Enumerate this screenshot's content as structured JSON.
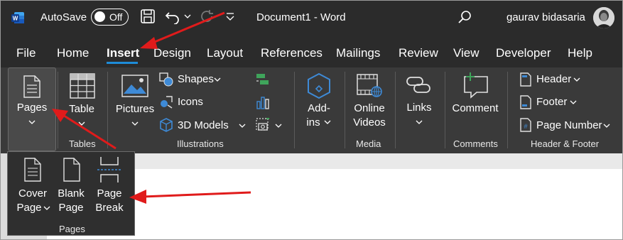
{
  "titlebar": {
    "autosave_label": "AutoSave",
    "autosave_state": "Off",
    "doc_title": "Document1  -  Word",
    "user_name": "gaurav bidasaria"
  },
  "tabs": [
    {
      "label": "File"
    },
    {
      "label": "Home"
    },
    {
      "label": "Insert",
      "active": true
    },
    {
      "label": "Design"
    },
    {
      "label": "Layout"
    },
    {
      "label": "References"
    },
    {
      "label": "Mailings"
    },
    {
      "label": "Review"
    },
    {
      "label": "View"
    },
    {
      "label": "Developer"
    },
    {
      "label": "Help"
    }
  ],
  "ribbon": {
    "pages": {
      "label": "Pages"
    },
    "tables": {
      "table_label": "Table",
      "group_label": "Tables"
    },
    "illustrations": {
      "pictures_label": "Pictures",
      "shapes_label": "Shapes",
      "icons_label": "Icons",
      "models_label": "3D Models",
      "group_label": "Illustrations"
    },
    "addins": {
      "line1": "Add-",
      "line2": "ins"
    },
    "media": {
      "line1": "Online",
      "line2": "Videos",
      "group_label": "Media"
    },
    "links": {
      "label": "Links"
    },
    "comments": {
      "label": "Comment",
      "group_label": "Comments"
    },
    "header_footer": {
      "header_label": "Header",
      "footer_label": "Footer",
      "page_number_label": "Page Number",
      "group_label": "Header & Footer"
    }
  },
  "flyout": {
    "cover": {
      "line1": "Cover",
      "line2": "Page"
    },
    "blank": {
      "line1": "Blank",
      "line2": "Page"
    },
    "break": {
      "line1": "Page",
      "line2": "Break"
    },
    "group_label": "Pages"
  },
  "colors": {
    "accent": "#1e8cd8",
    "arrow": "#e01b1b",
    "titlebar": "#2b2b2b",
    "ribbon": "#3a3a3a"
  }
}
